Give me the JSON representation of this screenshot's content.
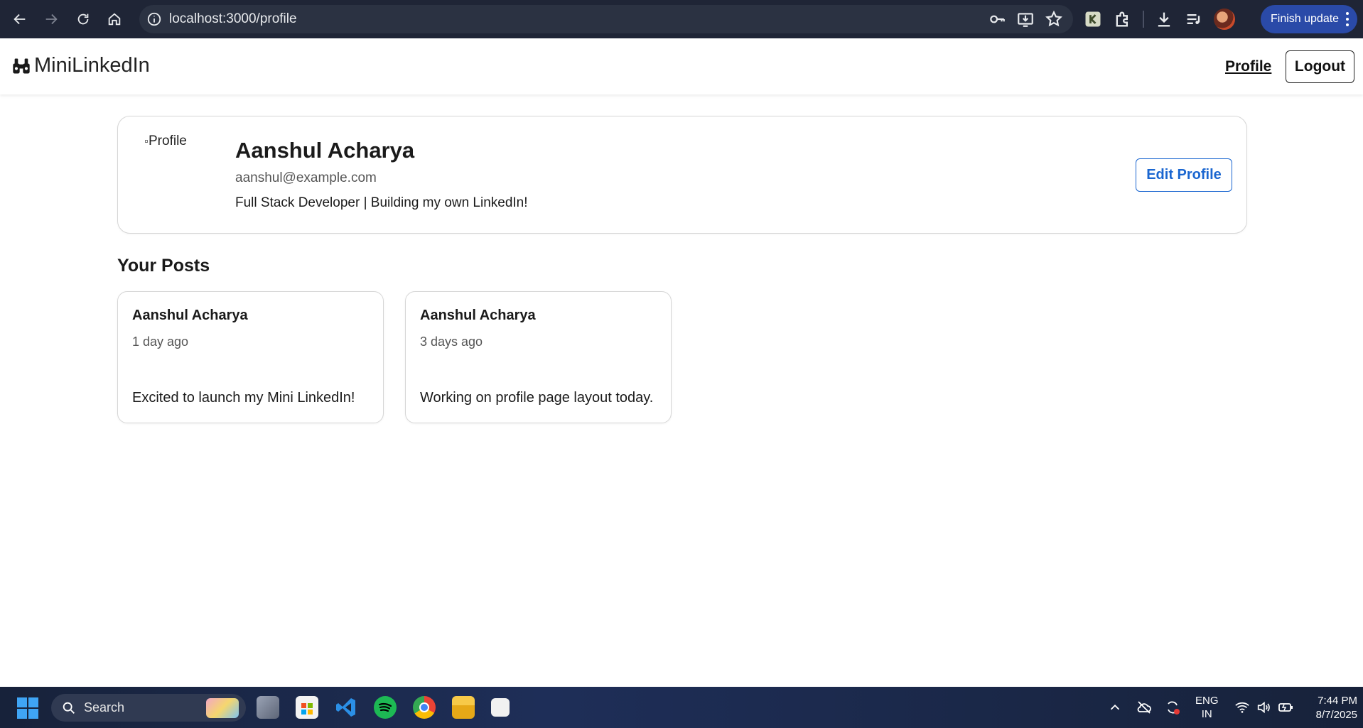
{
  "browser": {
    "url": "localhost:3000/profile",
    "finish_update_label": "Finish update",
    "accent": "#2a4aa8"
  },
  "app_nav": {
    "brand": "MiniLinkedIn",
    "brand_icon": "binoculars-icon",
    "profile_link": "Profile",
    "logout_label": "Logout"
  },
  "profile": {
    "image_alt": "Profile",
    "name": "Aanshul Acharya",
    "email": "aanshul@example.com",
    "bio": "Full Stack Developer | Building my own LinkedIn!",
    "edit_label": "Edit Profile",
    "accent": "#1a66d0"
  },
  "posts_section": {
    "heading": "Your Posts",
    "posts": [
      {
        "author": "Aanshul Acharya",
        "time": "1 day ago",
        "content": "Excited to launch my Mini LinkedIn!"
      },
      {
        "author": "Aanshul Acharya",
        "time": "3 days ago",
        "content": "Working on profile page layout today."
      }
    ]
  },
  "taskbar": {
    "search_label": "Search",
    "language_line1": "ENG",
    "language_line2": "IN",
    "time": "7:44 PM",
    "date": "8/7/2025"
  }
}
